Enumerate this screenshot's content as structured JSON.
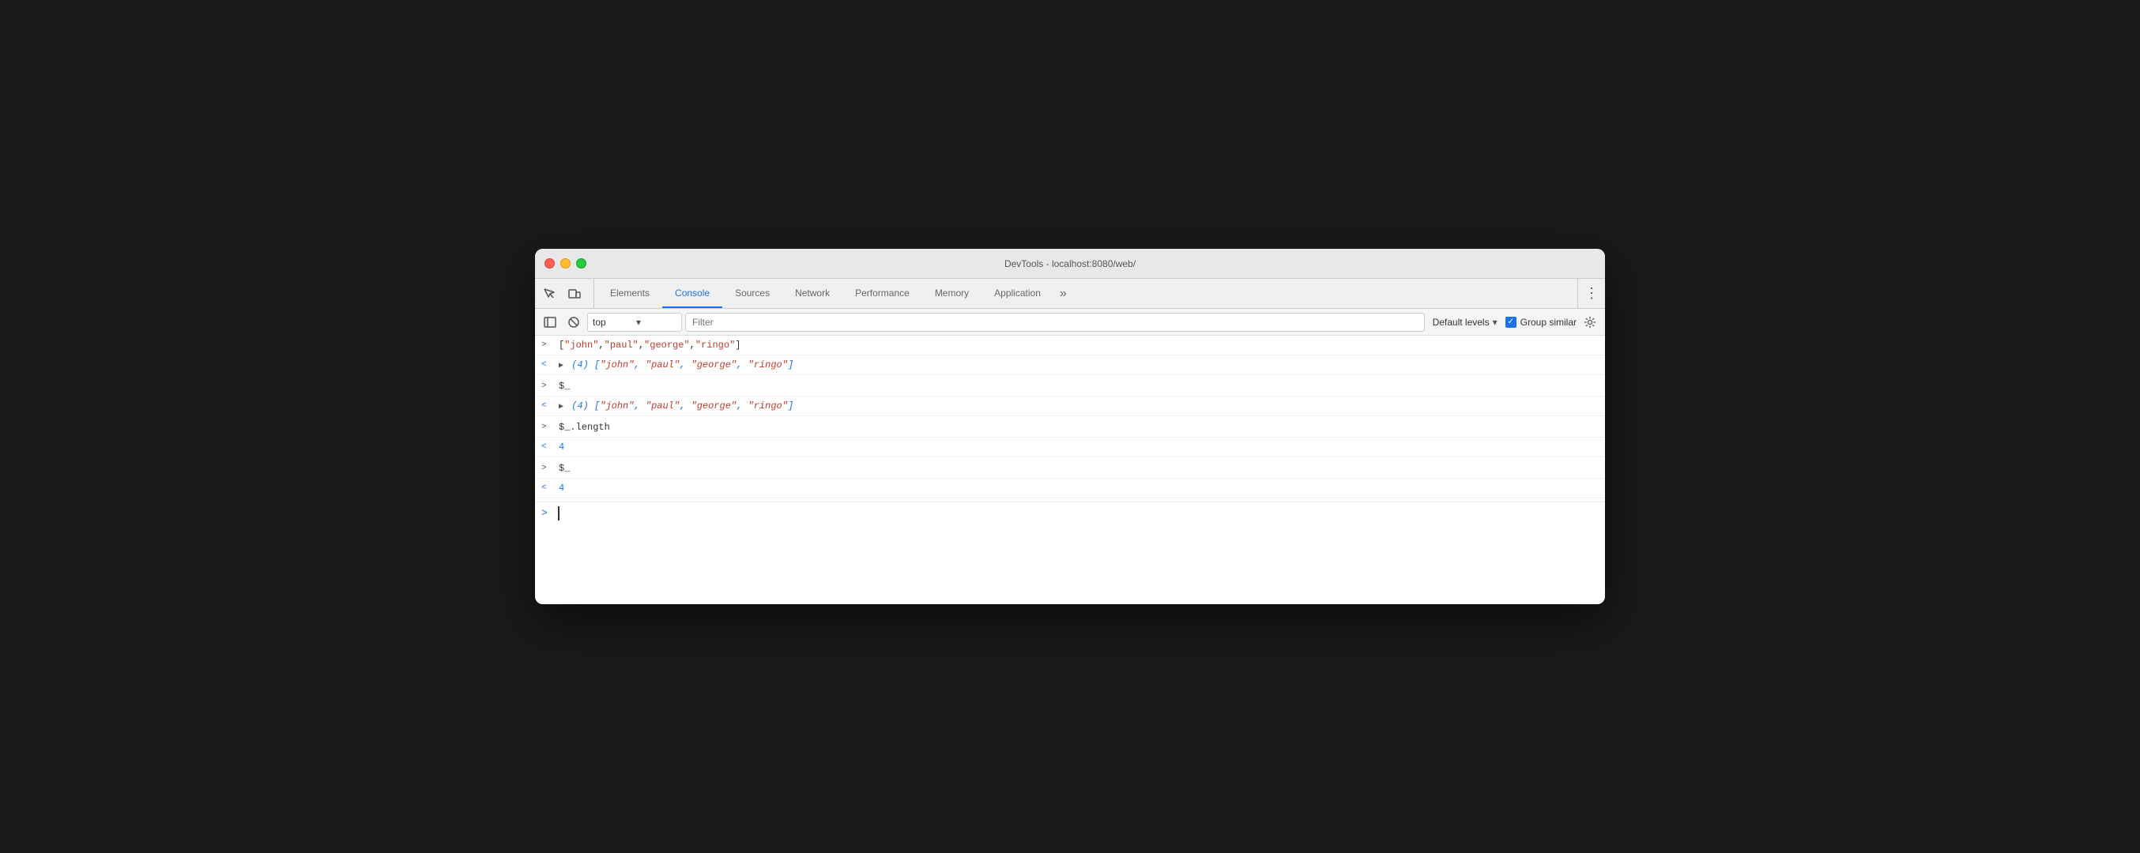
{
  "window": {
    "title": "DevTools - localhost:8080/web/"
  },
  "tabs": {
    "items": [
      {
        "id": "elements",
        "label": "Elements",
        "active": false
      },
      {
        "id": "console",
        "label": "Console",
        "active": true
      },
      {
        "id": "sources",
        "label": "Sources",
        "active": false
      },
      {
        "id": "network",
        "label": "Network",
        "active": false
      },
      {
        "id": "performance",
        "label": "Performance",
        "active": false
      },
      {
        "id": "memory",
        "label": "Memory",
        "active": false
      },
      {
        "id": "application",
        "label": "Application",
        "active": false
      }
    ],
    "more_label": "»",
    "kebab_label": "⋮"
  },
  "toolbar": {
    "top_value": "top",
    "filter_placeholder": "Filter",
    "default_levels_label": "Default levels",
    "group_similar_label": "Group similar"
  },
  "console": {
    "rows": [
      {
        "direction": ">",
        "content_type": "code",
        "text": "[\"john\",\"paul\",\"george\",\"ringo\"]"
      },
      {
        "direction": "<",
        "content_type": "array-expand",
        "prefix": "(4) [",
        "items": [
          "\"john\"",
          "\"paul\"",
          "\"george\"",
          "\"ringo\""
        ],
        "suffix": "]"
      },
      {
        "direction": ">",
        "content_type": "code",
        "text": "$_"
      },
      {
        "direction": "<",
        "content_type": "array-expand",
        "prefix": "(4) [",
        "items": [
          "\"john\"",
          "\"paul\"",
          "\"george\"",
          "\"ringo\""
        ],
        "suffix": "]"
      },
      {
        "direction": ">",
        "content_type": "code",
        "text": "$_.length"
      },
      {
        "direction": "<",
        "content_type": "number",
        "text": "4"
      },
      {
        "direction": ">",
        "content_type": "code",
        "text": "$_"
      },
      {
        "direction": "<",
        "content_type": "number",
        "text": "4"
      }
    ],
    "input_prompt": ">"
  }
}
